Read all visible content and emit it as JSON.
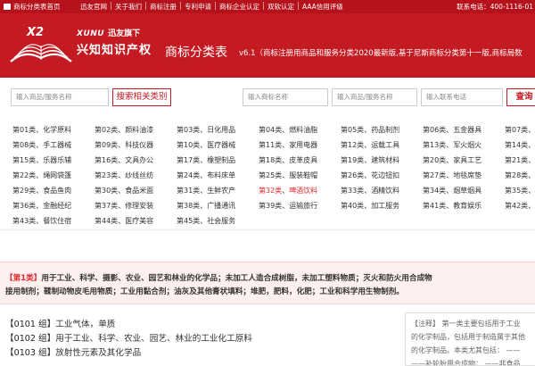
{
  "topbar": {
    "home": "商标分类表首页",
    "nav": [
      "迅友官网",
      "关于我们",
      "商标注册",
      "专利申请",
      "商标企业认定",
      "双软认定",
      "AAA信用评级"
    ],
    "phone": "联系电话：400-1116-01"
  },
  "header": {
    "brand_en": "XUNU",
    "brand_cn1": "迅友旗下",
    "brand_cn2": "兴知知识产权",
    "title": "商标分类表",
    "subtitle": "v6.1（商标注册用商品和服务分类2020最新版,基于尼斯商标分类第十一版,商标局数"
  },
  "search": {
    "ph1": "输入商品/服务名称",
    "btn1": "搜索相关类别",
    "ph2": "输入商标名称",
    "ph3": "输入商品/服务名称",
    "ph4": "输入联系电话",
    "btn2": "查询"
  },
  "categories": [
    [
      "第01类",
      "化学原料"
    ],
    [
      "第02类",
      "颜料油漆"
    ],
    [
      "第03类",
      "日化用品"
    ],
    [
      "第04类",
      "燃料油脂"
    ],
    [
      "第05类",
      "药品制剂"
    ],
    [
      "第06类",
      "五金器具"
    ],
    [
      "第07类",
      "机械"
    ],
    [
      "第08类",
      "手工器械"
    ],
    [
      "第09类",
      "科技仪器"
    ],
    [
      "第10类",
      "医疗器械"
    ],
    [
      "第11类",
      "家用电器"
    ],
    [
      "第12类",
      "运载工具"
    ],
    [
      "第13类",
      "军火烟火"
    ],
    [
      "第14类",
      "珠宝"
    ],
    [
      "第15类",
      "乐器乐辅"
    ],
    [
      "第16类",
      "文具办公"
    ],
    [
      "第17类",
      "橡塑制品"
    ],
    [
      "第18类",
      "皮革皮具"
    ],
    [
      "第19类",
      "建筑材料"
    ],
    [
      "第20类",
      "家具工艺"
    ],
    [
      "第21类",
      "厨具"
    ],
    [
      "第22类",
      "绳网袋篷"
    ],
    [
      "第23类",
      "纱线丝纺"
    ],
    [
      "第24类",
      "布料床单"
    ],
    [
      "第25类",
      "服装鞋帽"
    ],
    [
      "第26类",
      "花边钮扣"
    ],
    [
      "第27类",
      "地毯席垫"
    ],
    [
      "第28类",
      "玩具"
    ],
    [
      "第29类",
      "食品鱼肉"
    ],
    [
      "第30类",
      "食品米面"
    ],
    [
      "第31类",
      "生鲜农产"
    ],
    [
      "第32类",
      "啤酒饮料"
    ],
    [
      "第33类",
      "酒精饮料"
    ],
    [
      "第34类",
      "烟草烟具"
    ],
    [
      "第35类",
      "广告"
    ],
    [
      "第36类",
      "金融经纪"
    ],
    [
      "第37类",
      "修理安装"
    ],
    [
      "第38类",
      "广播通讯"
    ],
    [
      "第39类",
      "运输旅行"
    ],
    [
      "第40类",
      "加工服务"
    ],
    [
      "第41类",
      "教育娱乐"
    ],
    [
      "第42类",
      "科"
    ],
    [
      "第43类",
      "餐饮住宿"
    ],
    [
      "第44类",
      "医疗美容"
    ],
    [
      "第45类",
      "社会服务"
    ]
  ],
  "highlight_index": 31,
  "description": {
    "label": "【第1类】",
    "line1": "用于工业、科学、摄影、农业、园艺和林业的化学品；未加工人造合成树脂，未加工塑料物质；灭火和防火用合成物",
    "line2": "接用制剂；鞣制动物皮毛用物质；工业用黏合剂；油灰及其他膏状填料；堆肥，肥料，化肥；工业和科学用生物制剂。"
  },
  "groups": [
    {
      "code": "【0101 组】",
      "text": "工业气体，单质"
    },
    {
      "code": "【0102 组】",
      "text": "用于工业、科学、农业、园艺、林业的工业化工原料"
    },
    {
      "code": "【0103 组】",
      "text": "放射性元素及其化学品"
    }
  ],
  "note": {
    "label": "【注释】",
    "l1": "第一类主要包括用于工业",
    "l2": "的化学制品，包括用于制造属于其他",
    "l3": "的化学制品。本类尤其包括：  ——",
    "l4": "——补轮胎用合成物；    ——非食品"
  }
}
